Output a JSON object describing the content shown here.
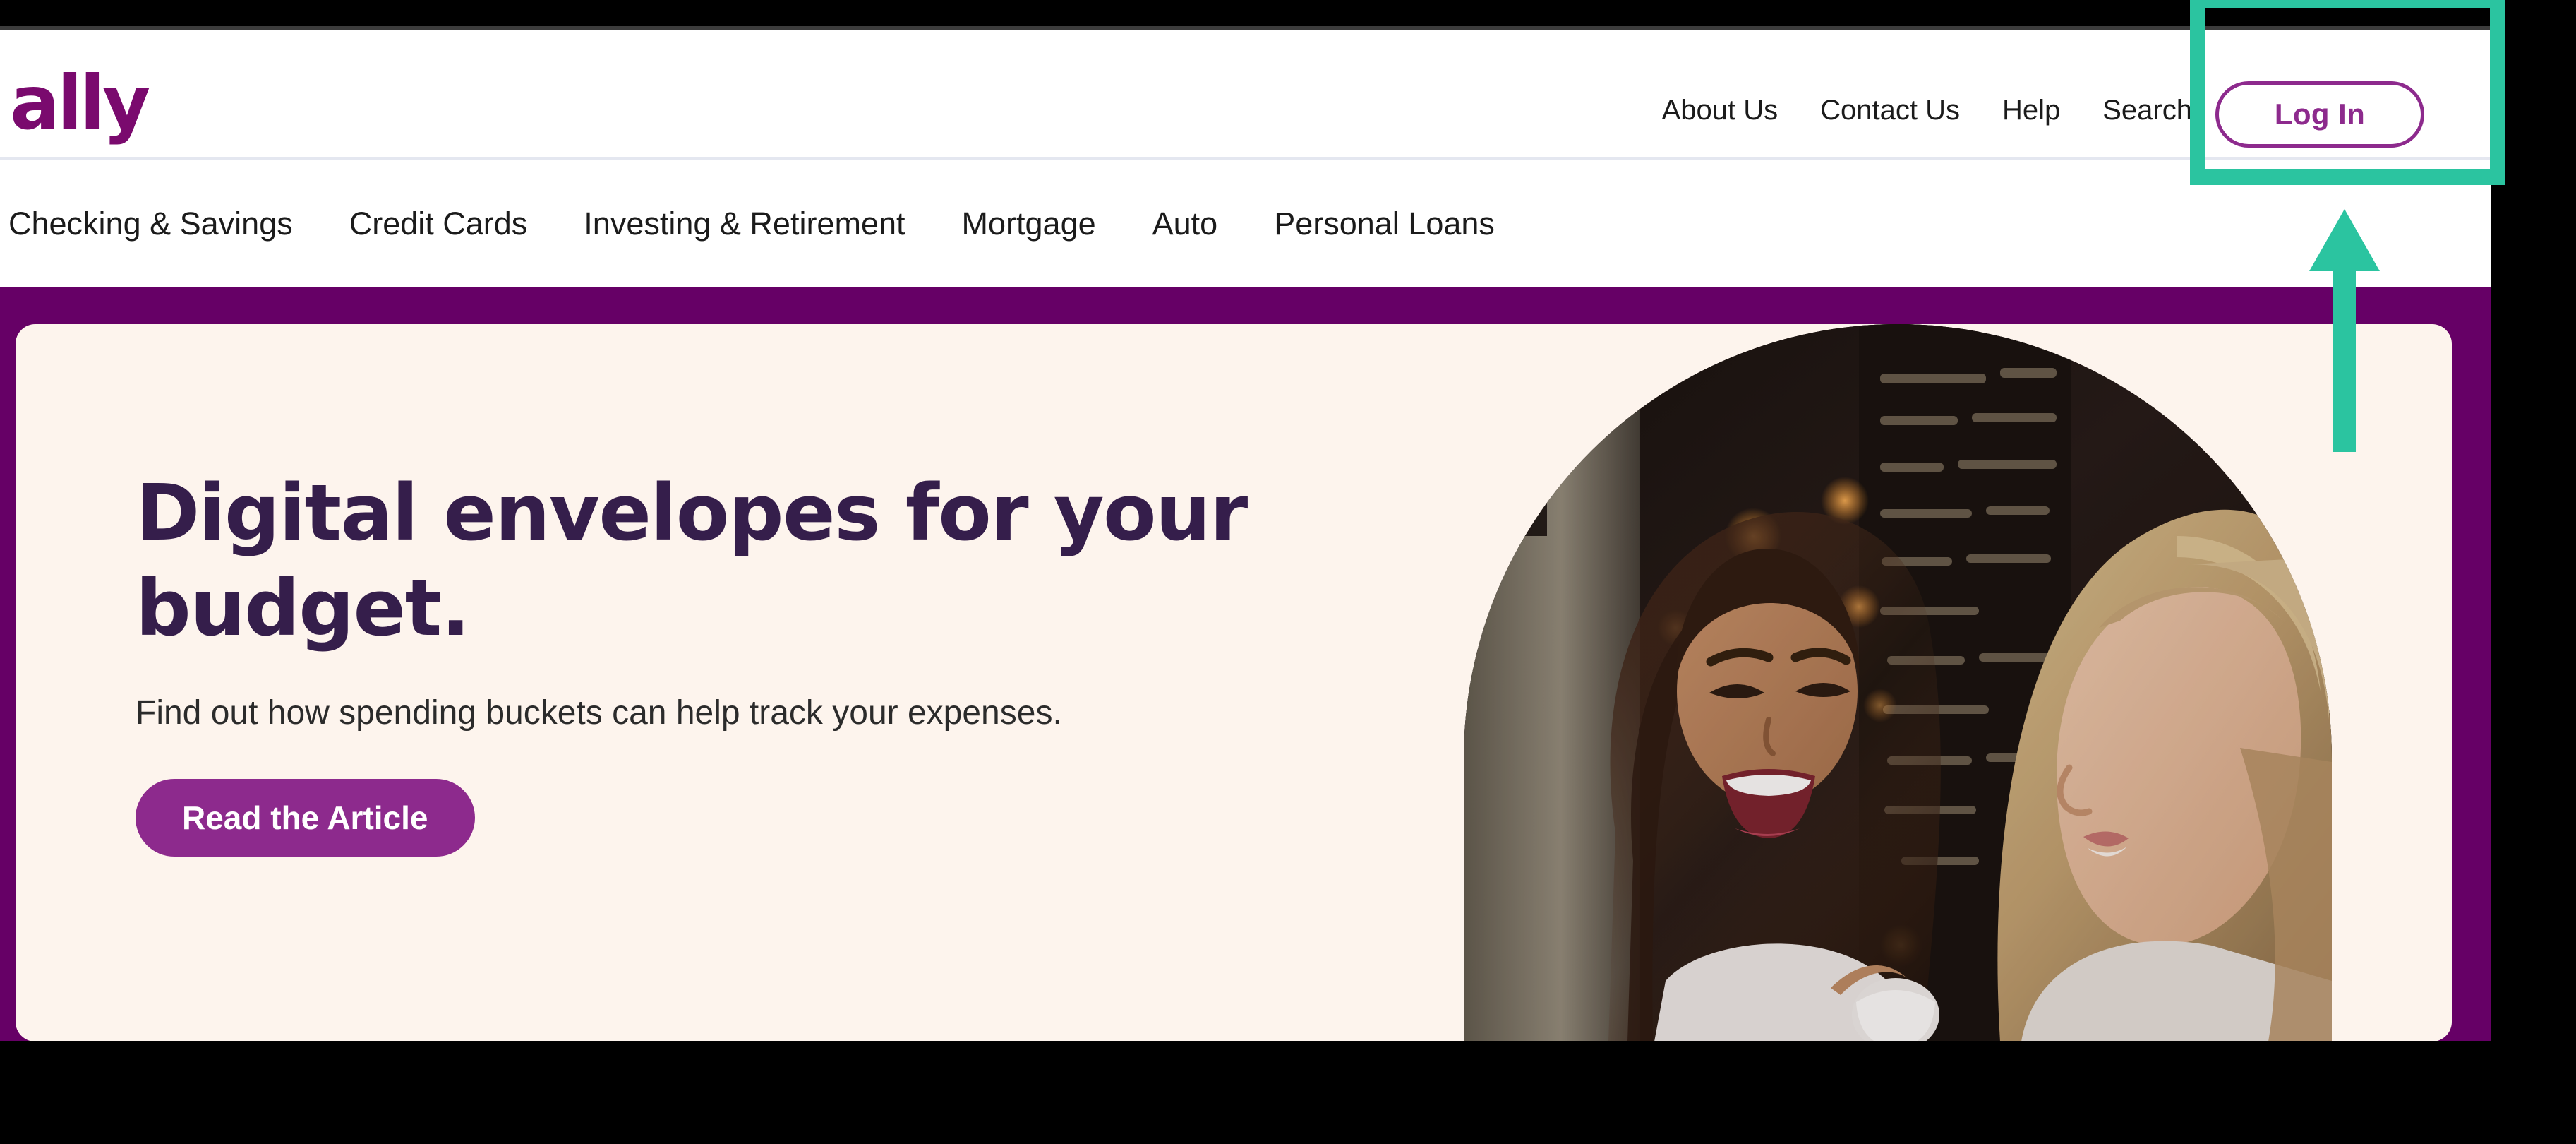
{
  "brand": {
    "logo_text": "ally",
    "logo_color": "#7a0a6e",
    "accent_purple": "#660066",
    "button_purple": "#8d2a8d",
    "hero_card_bg": "#fdf4ed",
    "headline_color": "#351e4b",
    "annotation_color": "#2bc4a0"
  },
  "header": {
    "utility_nav": [
      {
        "label": "About Us"
      },
      {
        "label": "Contact Us"
      },
      {
        "label": "Help"
      },
      {
        "label": "Search"
      }
    ],
    "search_icon": "search-icon",
    "login_label": "Log In"
  },
  "main_nav": {
    "items": [
      {
        "label": "Checking & Savings"
      },
      {
        "label": "Credit Cards"
      },
      {
        "label": "Investing & Retirement"
      },
      {
        "label": "Mortgage"
      },
      {
        "label": "Auto"
      },
      {
        "label": "Personal Loans"
      }
    ]
  },
  "hero": {
    "title": "Digital envelopes for your budget.",
    "subtitle": "Find out how spending buckets can help track your expenses.",
    "cta_label": "Read the Article",
    "image_alt": "Two women laughing together at a cafe"
  },
  "annotation": {
    "target": "Log In",
    "box_shape": "rectangle-outline",
    "arrow_direction": "up",
    "color": "#2bc4a0"
  }
}
